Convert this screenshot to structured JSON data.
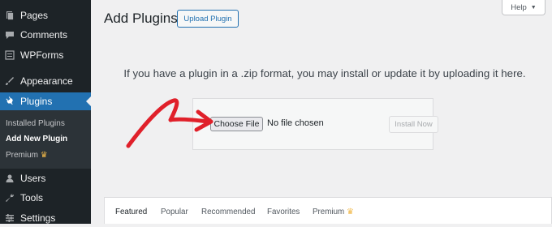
{
  "sidebar": {
    "items": [
      {
        "label": "Pages",
        "icon": "pages-icon"
      },
      {
        "label": "Comments",
        "icon": "comments-icon"
      },
      {
        "label": "WPForms",
        "icon": "wpforms-icon"
      },
      {
        "label": "Appearance",
        "icon": "appearance-icon"
      },
      {
        "label": "Plugins",
        "icon": "plugins-icon"
      },
      {
        "label": "Users",
        "icon": "users-icon"
      },
      {
        "label": "Tools",
        "icon": "tools-icon"
      },
      {
        "label": "Settings",
        "icon": "settings-icon"
      }
    ],
    "submenu": [
      "Installed Plugins",
      "Add New Plugin",
      "Premium"
    ],
    "active_color": "#2271b1"
  },
  "header": {
    "title": "Add Plugins",
    "upload_label": "Upload Plugin",
    "help_label": "Help"
  },
  "upload": {
    "instructions": "If you have a plugin in a .zip format, you may install or update it by uploading it here.",
    "choose_file_label": "Choose File",
    "no_file_text": "No file chosen",
    "install_label": "Install Now"
  },
  "tabs": [
    "Featured",
    "Popular",
    "Recommended",
    "Favorites",
    "Premium"
  ],
  "annotation_color": "#e0202a"
}
